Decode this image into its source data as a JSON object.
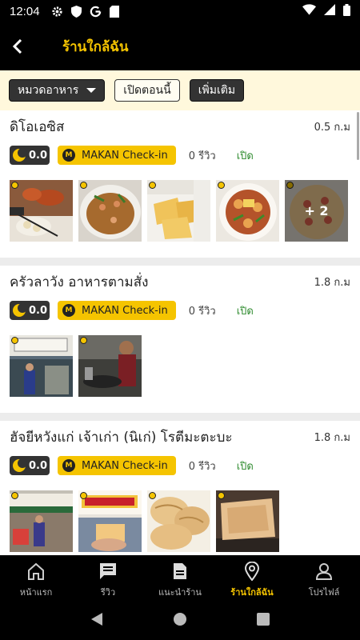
{
  "status": {
    "time": "12:04"
  },
  "header": {
    "title": "ร้านใกล้ฉัน"
  },
  "filters": {
    "category": "หมวดอาหาร",
    "open_now": "เปิดตอนนี้",
    "more": "เพิ่มเติม"
  },
  "restaurants": [
    {
      "name": "ดิโอเอซิส",
      "distance": "0.5 ก.ม",
      "rating": "0.0",
      "checkin": "MAKAN Check-in",
      "reviews": "0 รีวิว",
      "status": "เปิด",
      "photos": [
        "food-photo-skewers",
        "food-photo-fried-rice",
        "food-photo-fried-tofu",
        "food-photo-salad",
        "food-photo-pizza"
      ],
      "more_photos": "+ 2"
    },
    {
      "name": "ครัวลาวัง อาหารตามสั่ง",
      "distance": "1.8 ก.ม",
      "rating": "0.0",
      "checkin": "MAKAN Check-in",
      "reviews": "0 รีวิว",
      "status": "เปิด",
      "photos": [
        "storefront-photo",
        "chef-cooking-photo"
      ]
    },
    {
      "name": "ฮัจยีหวังแก่ เจ้าเก่า (นิเก่) โรตีมะตะบะ",
      "distance": "1.8 ก.ม",
      "rating": "0.0",
      "checkin": "MAKAN Check-in",
      "reviews": "0 รีวิว",
      "status": "เปิด",
      "photos": [
        "roti-stall-photo",
        "roti-sign-photo",
        "crispy-roti-photo",
        "murtabak-photo"
      ]
    }
  ],
  "nav": [
    {
      "label": "หน้าแรก",
      "icon": "home-icon"
    },
    {
      "label": "รีวิว",
      "icon": "review-icon"
    },
    {
      "label": "แนะนำร้าน",
      "icon": "document-icon"
    },
    {
      "label": "ร้านใกล้ฉัน",
      "icon": "location-pin-icon",
      "active": true
    },
    {
      "label": "โปรไฟล์",
      "icon": "person-icon"
    }
  ],
  "colors": {
    "accent": "#f5c400",
    "open": "#2e8b2e",
    "bar": "#000000",
    "filter_bg": "#fff8dc"
  }
}
